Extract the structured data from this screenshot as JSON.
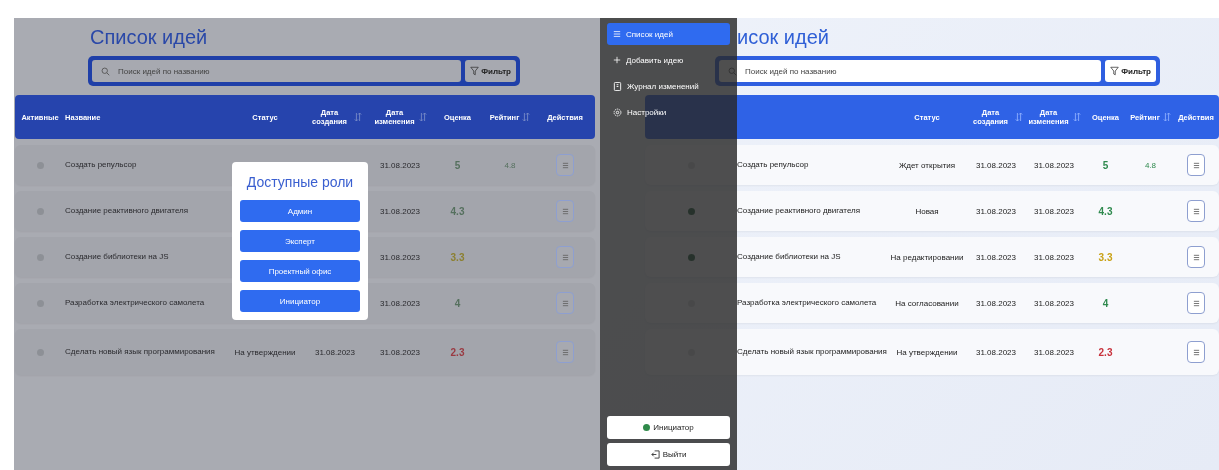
{
  "screens": [
    {
      "title": "Список идей",
      "dimmed": true,
      "search": {
        "placeholder": "Поиск идей по названию"
      },
      "filter": "Фильтр",
      "columns": [
        {
          "kind": "active",
          "label": "Активные",
          "sortable": false
        },
        {
          "kind": "name",
          "label": "Название",
          "sortable": false
        },
        {
          "kind": "status",
          "label": "Статус",
          "sortable": false
        },
        {
          "kind": "created",
          "label": "Дата создания",
          "sortable": true
        },
        {
          "kind": "modified",
          "label": "Дата изменения",
          "sortable": true
        },
        {
          "kind": "score",
          "label": "Оценка",
          "sortable": false
        },
        {
          "kind": "rating",
          "label": "Рейтинг",
          "sortable": true
        },
        {
          "kind": "actions",
          "label": "Действия",
          "sortable": false
        }
      ],
      "rows": [
        {
          "active": false,
          "name": "Создать репульсор",
          "modified": "31.08.2023",
          "score": "5",
          "color": "#55705e",
          "rating": "4.8"
        },
        {
          "active": false,
          "name": "Создание реактивного двигателя",
          "modified": "31.08.2023",
          "score": "4.3",
          "color": "#55705e"
        },
        {
          "active": false,
          "name": "Создание библиотеки на JS",
          "modified": "31.08.2023",
          "score": "3.3",
          "color": "#8c8030"
        },
        {
          "active": false,
          "name": "Разработка электрического самолета",
          "modified": "31.08.2023",
          "score": "4",
          "color": "#55705e"
        },
        {
          "active": false,
          "name": "Сделать новый язык программирования",
          "status": "На утверждении",
          "created": "31.08.2023",
          "modified": "31.08.2023",
          "score": "2.3",
          "color": "#9a3a42"
        }
      ],
      "modal": {
        "title": "Доступные роли",
        "buttons": [
          "Админ",
          "Эксперт",
          "Проектный офис",
          "Инициатор"
        ]
      }
    },
    {
      "title": "исок идей",
      "dimmed": false,
      "search": {
        "placeholder": "Поиск идей по названию"
      },
      "filter": "Фильтр",
      "columns": [
        {
          "kind": "status",
          "label": "Статус",
          "sortable": false
        },
        {
          "kind": "created",
          "label": "Дата создания",
          "sortable": true
        },
        {
          "kind": "modified",
          "label": "Дата изменения",
          "sortable": true
        },
        {
          "kind": "score",
          "label": "Оценка",
          "sortable": false
        },
        {
          "kind": "rating",
          "label": "Рейтинг",
          "sortable": true
        },
        {
          "kind": "actions",
          "label": "Действия",
          "sortable": false
        }
      ],
      "rows": [
        {
          "active": false,
          "name": "Создать репульсор",
          "status": "Ждет открытия",
          "created": "31.08.2023",
          "modified": "31.08.2023",
          "score": "5",
          "color": "#2f8a4e",
          "rating": "4.8"
        },
        {
          "active": true,
          "name": "Создание реактивного двигателя",
          "status": "Новая",
          "created": "31.08.2023",
          "modified": "31.08.2023",
          "score": "4.3",
          "color": "#2f8a4e"
        },
        {
          "active": true,
          "name": "Создание библиотеки на JS",
          "status": "На редактировании",
          "created": "31.08.2023",
          "modified": "31.08.2023",
          "score": "3.3",
          "color": "#c9a216"
        },
        {
          "active": false,
          "name": "Разработка электрического самолета",
          "status": "На согласовании",
          "created": "31.08.2023",
          "modified": "31.08.2023",
          "score": "4",
          "color": "#2f8a4e"
        },
        {
          "active": false,
          "name": "Сделать новый язык программирования",
          "status": "На утверждении",
          "created": "31.08.2023",
          "modified": "31.08.2023",
          "score": "2.3",
          "color": "#c8323c"
        }
      ],
      "sidebar": {
        "items": [
          {
            "kind": "list",
            "label": "Список идей",
            "selected": true
          },
          {
            "kind": "add",
            "label": "Добавить идею",
            "selected": false
          },
          {
            "kind": "log",
            "label": "Журнал изменений",
            "selected": false
          },
          {
            "kind": "settings",
            "label": "Настройки",
            "selected": false
          }
        ],
        "role": {
          "label": "Инициатор",
          "color": "#2f8a4a"
        },
        "logout": "Выйти"
      }
    }
  ]
}
